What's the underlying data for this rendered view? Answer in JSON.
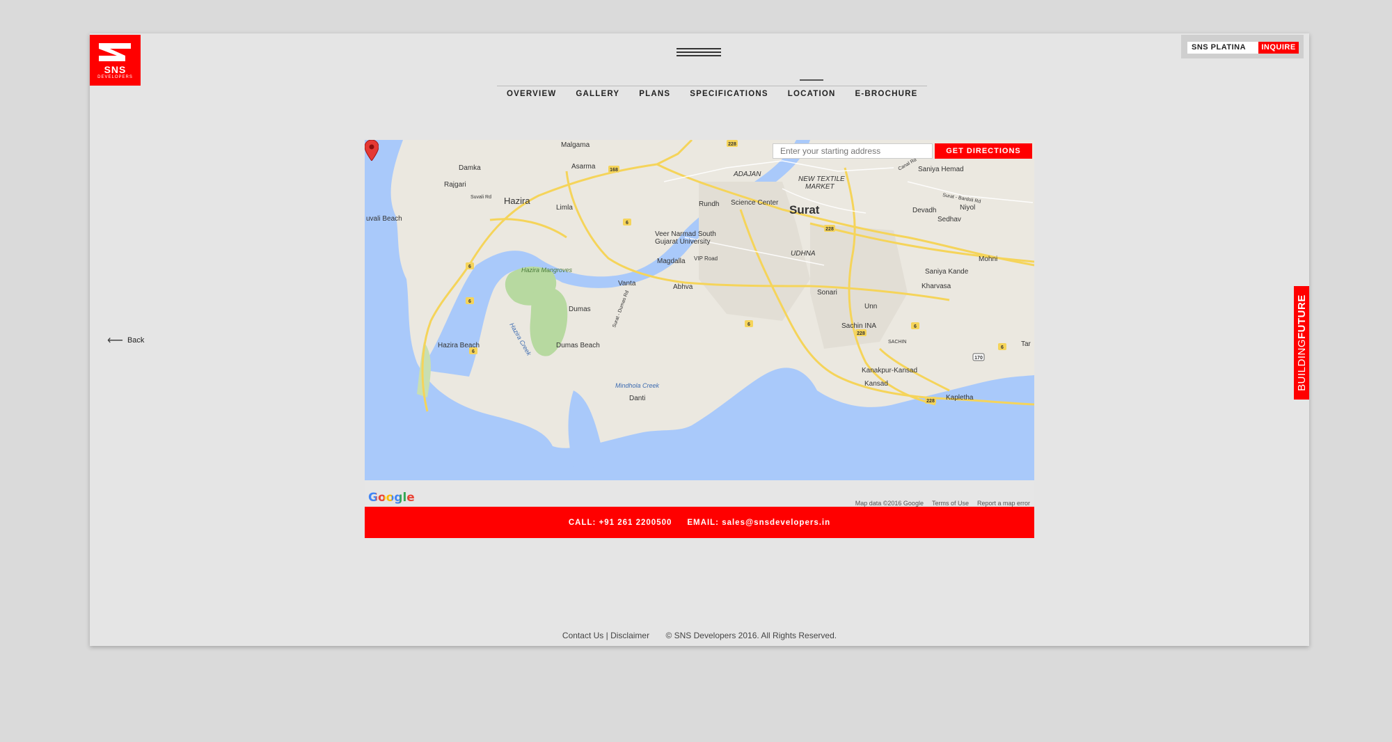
{
  "brand": {
    "logo_text": "SNS",
    "logo_sub": "DEVELOPERS",
    "accent": "#ff0000"
  },
  "project": {
    "name": "SNS PLATINA",
    "inquire": "INQUIRE"
  },
  "nav": [
    {
      "label": "OVERVIEW"
    },
    {
      "label": "GALLERY"
    },
    {
      "label": "PLANS"
    },
    {
      "label": "SPECIFICATIONS"
    },
    {
      "label": "LOCATION",
      "active": true
    },
    {
      "label": "E-BROCHURE"
    }
  ],
  "back_label": "Back",
  "side_tab": {
    "part1": "BUILDING",
    "part2": "FUTURE"
  },
  "map": {
    "directions_placeholder": "Enter your starting address",
    "directions_button": "GET DIRECTIONS",
    "google_logo": "Google",
    "map_data": "Map data ©2016 Google",
    "terms": "Terms of Use",
    "report": "Report a map error",
    "places": {
      "malgama": "Malgama",
      "damka": "Damka",
      "asarma": "Asarma",
      "rajgari": "Rajgari",
      "hazira": "Hazira",
      "limla": "Limla",
      "rundh": "Rundh",
      "science_center": "Science Center",
      "surat": "Surat",
      "adajan": "ADAJAN",
      "new_textile": "NEW TEXTILE",
      "market": "MARKET",
      "saniya_hemad": "Saniya Hemad",
      "devadh": "Devadh",
      "niyol": "Niyol",
      "sedhav": "Sedhav",
      "uvali_beach": "uvali Beach",
      "veer_narmad": "Veer Narmad South",
      "gujarat_univ": "Gujarat University",
      "magdalla": "Magdalla",
      "vip_road": "VIP Road",
      "udhna": "UDHNA",
      "mohni": "Mohni",
      "hazira_mangroves": "Hazira Mangroves",
      "vanta": "Vanta",
      "abhva": "Abhva",
      "saniya_kande": "Saniya Kande",
      "kharvasa": "Kharvasa",
      "sonari": "Sonari",
      "dumas": "Dumas",
      "unn": "Unn",
      "sachin_ina": "Sachin INA",
      "hazira_beach": "Hazira Beach",
      "dumas_beach": "Dumas Beach",
      "hazira_creek": "Hazira Creek",
      "kanakpur": "Kanakpur-Kansad",
      "kansad": "Kansad",
      "mindhola": "Mindhola Creek",
      "danti": "Danti",
      "kapletha": "Kapletha",
      "sachin": "SACHIN",
      "tar": "Tar",
      "suvali_rd": "Suvali Rd",
      "canal_rd": "Canal Rd",
      "surat_bardoli": "Surat - Bardoli Rd",
      "surat_dumas": "Surat - Dumas Rd"
    },
    "shields": [
      "228",
      "168",
      "6",
      "6",
      "6",
      "6",
      "6",
      "6",
      "228",
      "228",
      "228",
      "170",
      "6"
    ]
  },
  "contact": {
    "call": "CALL: +91 261 2200500",
    "email": "EMAIL: sales@snsdevelopers.in"
  },
  "footer": {
    "contact": "Contact Us",
    "sep": "|",
    "disclaimer": "Disclaimer",
    "copyright": "© SNS Developers 2016. All Rights Reserved."
  }
}
